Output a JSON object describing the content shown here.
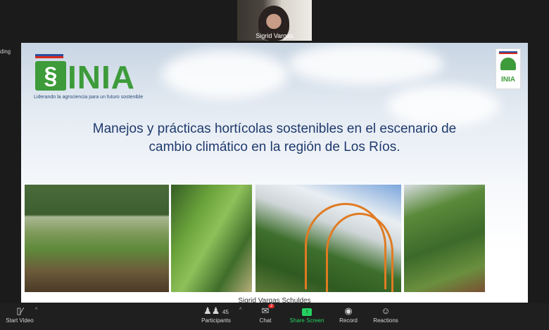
{
  "participant_video": {
    "name": "Sigrid Vargas"
  },
  "recording_indicator": "ding",
  "slide": {
    "logo": {
      "brand": "INIA",
      "tagline": "Liderando la agrociencia para un futuro sostenible"
    },
    "right_logo_text": "INIA",
    "title_line1": "Manejos y prácticas hortícolas sostenibles en el escenario de",
    "title_line2": "cambio climático en la región de Los Ríos.",
    "presenter_caption": "Sigrid Vargas Schuldes"
  },
  "toolbar": {
    "start_video": "Start Video",
    "participants": "Participants",
    "participants_count": "45",
    "chat": "Chat",
    "chat_badge": "2",
    "share_screen": "Share Screen",
    "record": "Record",
    "reactions": "Reactions"
  },
  "colors": {
    "brand_green": "#3d9b3a",
    "title_blue": "#1f3a6e",
    "share_green": "#23d160",
    "badge_red": "#e02828"
  }
}
